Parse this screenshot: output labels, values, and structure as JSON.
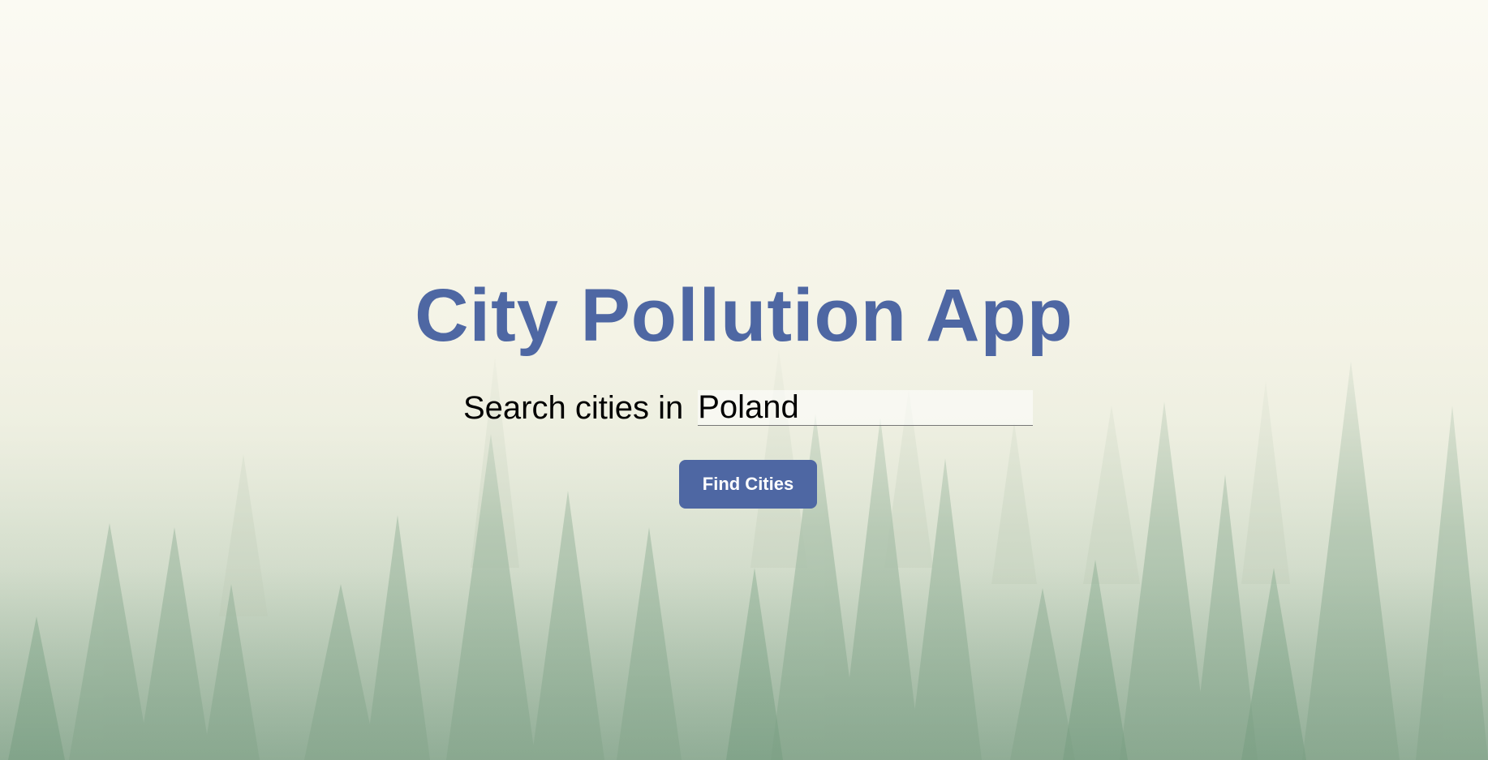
{
  "app": {
    "title": "City Pollution App"
  },
  "search": {
    "label": "Search cities in",
    "value": "Poland"
  },
  "actions": {
    "find_label": "Find Cities"
  },
  "theme": {
    "accent": "#4e67a3",
    "button_text": "#ffffff"
  },
  "background": {
    "icon": "misty-forest-image"
  }
}
